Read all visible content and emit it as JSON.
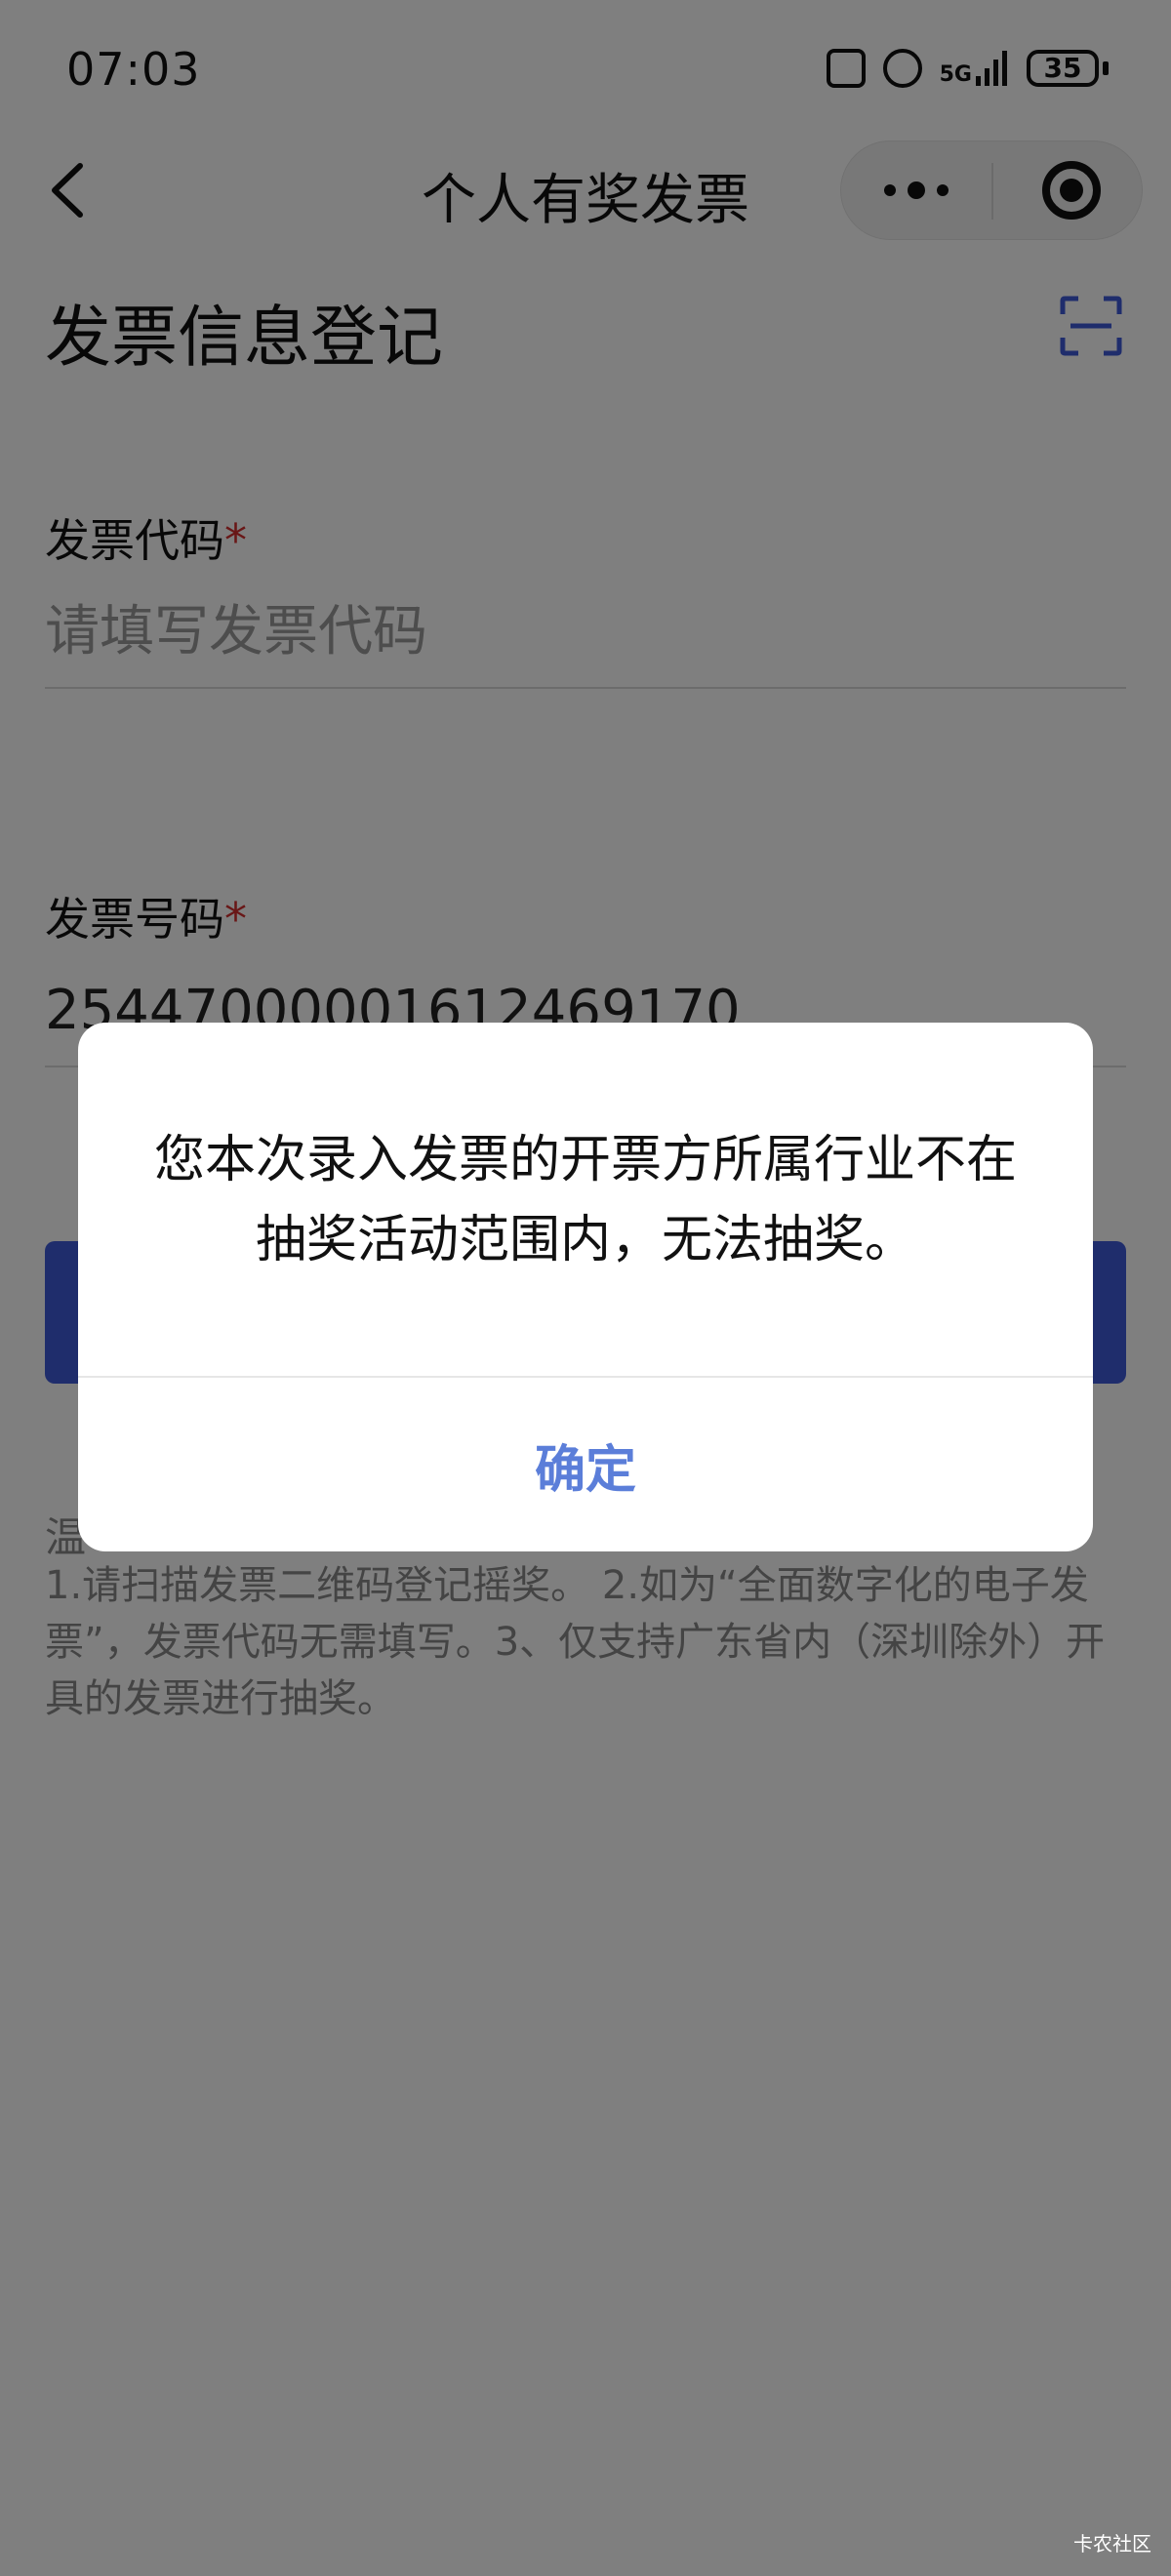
{
  "status_bar": {
    "time": "07:03",
    "network_label": "5G",
    "battery": "35",
    "icons": [
      "nfc-icon",
      "alarm-icon",
      "signal-icon",
      "battery-icon"
    ]
  },
  "nav": {
    "title": "个人有奖发票",
    "back_icon": "chevron-left-icon",
    "more_icon": "more-dots-icon",
    "close_icon": "target-close-icon"
  },
  "form": {
    "title": "发票信息登记",
    "scan_icon": "scan-icon",
    "invoice_code": {
      "label": "发票代码",
      "required_mark": "*",
      "placeholder": "请填写发票代码",
      "value": ""
    },
    "invoice_number": {
      "label": "发票号码",
      "required_mark": "*",
      "value": "25447000001612469170"
    },
    "submit_color": "#3f5bd9",
    "tips_head": "温",
    "tips": "1.请扫描发票二维码登记摇奖。 2.如为“全面数字化的电子发票”，发票代码无需填写。3、仅支持广东省内（深圳除外）开具的发票进行抽奖。"
  },
  "dialog": {
    "message": "您本次录入发票的开票方所属行业不在抽奖活动范围内，无法抽奖。",
    "confirm_label": "确定",
    "confirm_color": "#5b7ed9"
  },
  "watermark": "卡农社区"
}
